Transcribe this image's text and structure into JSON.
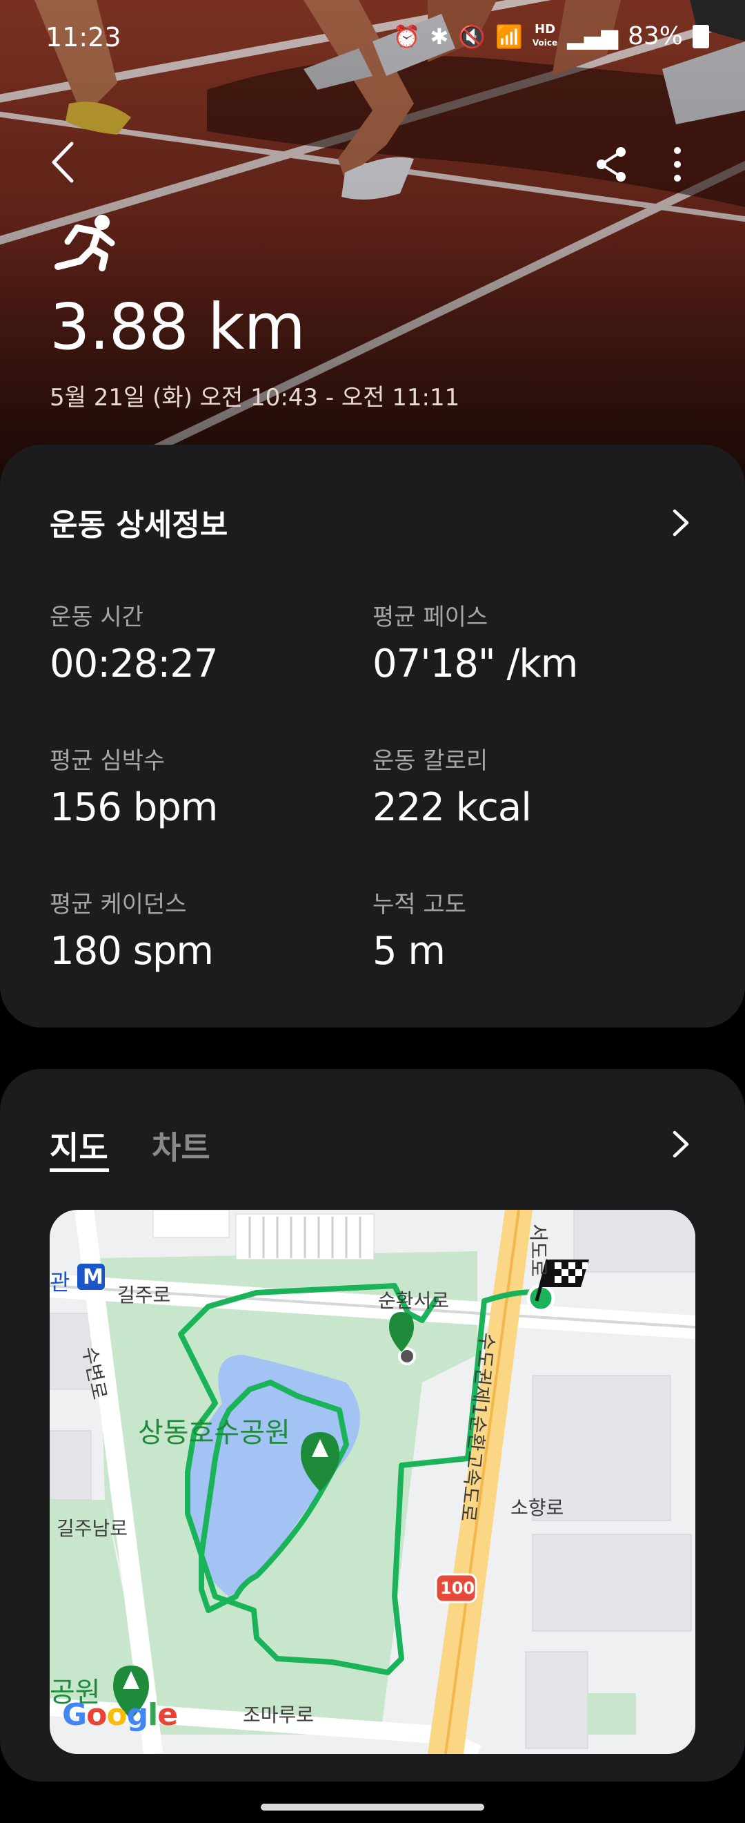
{
  "status_bar": {
    "time": "11:23",
    "hd_label_top": "HD",
    "hd_label_bottom": "Voice",
    "battery": "83%"
  },
  "header": {
    "distance": "3.88 km",
    "datetime": "5월 21일 (화) 오전 10:43 - 오전 11:11",
    "activity_icon": "running-person-icon"
  },
  "details": {
    "title": "운동 상세정보",
    "stats": [
      {
        "label": "운동 시간",
        "value": "00:28:27"
      },
      {
        "label": "평균 페이스",
        "value": "07'18\" /km"
      },
      {
        "label": "평균 심박수",
        "value": "156 bpm"
      },
      {
        "label": "운동 칼로리",
        "value": "222 kcal"
      },
      {
        "label": "평균 케이던스",
        "value": "180 spm"
      },
      {
        "label": "누적 고도",
        "value": "5 m"
      }
    ]
  },
  "map_card": {
    "tabs": [
      {
        "label": "지도",
        "selected": true
      },
      {
        "label": "차트",
        "selected": false
      }
    ],
    "labels": {
      "gwan": "관",
      "metro": "M",
      "giljuro": "길주로",
      "suyeonro": "수변로",
      "sunhwanseoro": "순환서로",
      "park": "상동호수공원",
      "giljunamro": "길주남로",
      "gongwon": "공원",
      "highway": "수도권제1순환고속도로",
      "sohyangro": "소향로",
      "route": "100",
      "jomaruro": "조마루로",
      "seodoro": "서도로",
      "google": "Google"
    }
  },
  "colors": {
    "card_bg": "#1c1c1e",
    "route": "#1ab35a",
    "park": "#b7dfbf",
    "lake": "#a4c3f5",
    "highway": "#f9d48a"
  }
}
